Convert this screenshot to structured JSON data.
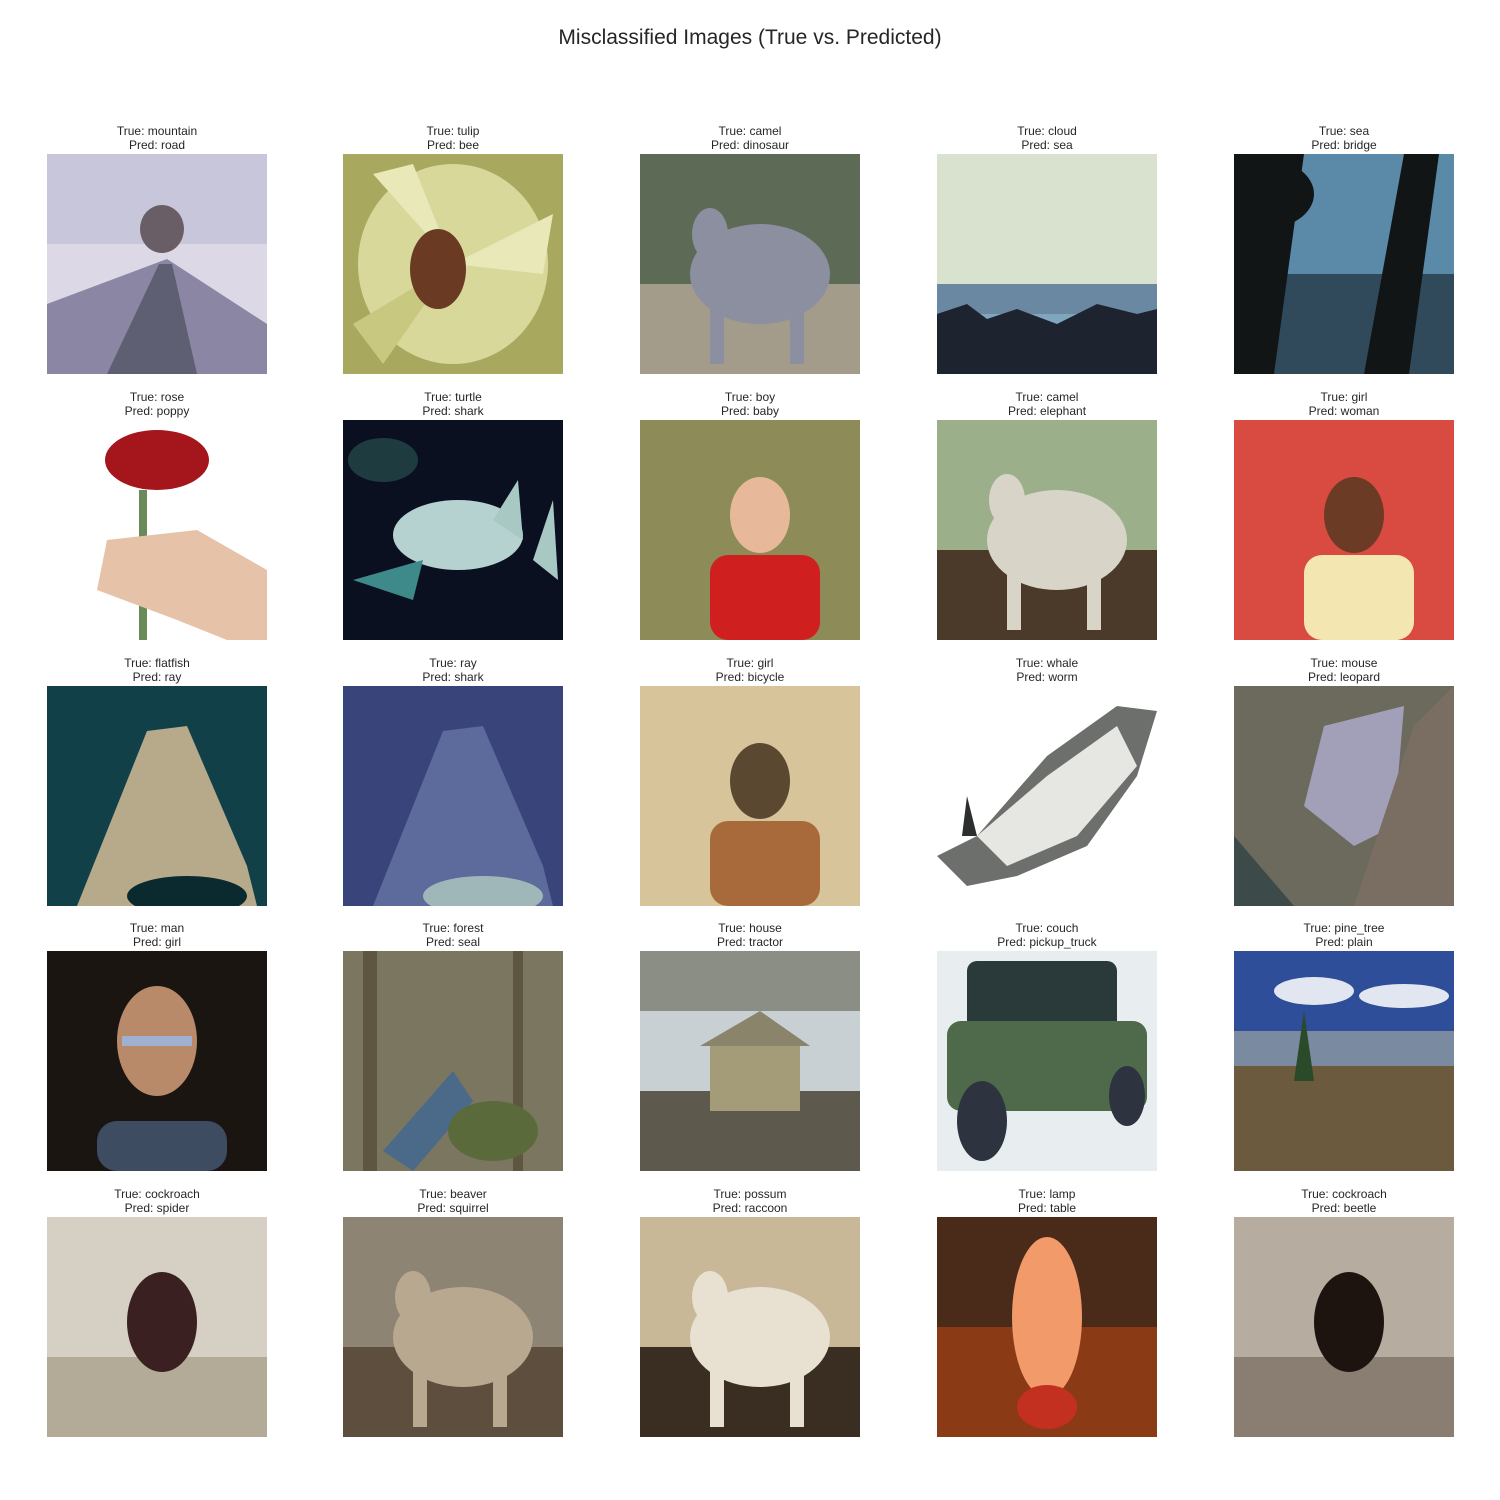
{
  "title": "Misclassified Images (True vs. Predicted)",
  "items": [
    {
      "true_label": "True: mountain",
      "pred_label": "Pred: road",
      "scene": "mountain-road",
      "colors": [
        "#dcd8e6",
        "#8a86a4",
        "#5e5f72"
      ]
    },
    {
      "true_label": "True: tulip",
      "pred_label": "Pred: bee",
      "scene": "flower",
      "colors": [
        "#a9a85f",
        "#d8d89a",
        "#6a3a22"
      ]
    },
    {
      "true_label": "True: camel",
      "pred_label": "Pred: dinosaur",
      "scene": "animal",
      "colors": [
        "#5d6a55",
        "#a49c8a",
        "#8b8fa0"
      ]
    },
    {
      "true_label": "True: cloud",
      "pred_label": "Pred: sea",
      "scene": "sky",
      "colors": [
        "#d9e2cf",
        "#7fa6bd",
        "#1d2430"
      ]
    },
    {
      "true_label": "True: sea",
      "pred_label": "Pred: bridge",
      "scene": "sea",
      "colors": [
        "#5b8aa8",
        "#304a5c",
        "#111516"
      ]
    },
    {
      "true_label": "True: rose",
      "pred_label": "Pred: poppy",
      "scene": "rose",
      "colors": [
        "#ffffff",
        "#a4161b",
        "#e6c3a8"
      ]
    },
    {
      "true_label": "True: turtle",
      "pred_label": "Pred: shark",
      "scene": "turtle",
      "colors": [
        "#0a1020",
        "#3e8a8a",
        "#b6d2d0"
      ]
    },
    {
      "true_label": "True: boy",
      "pred_label": "Pred: baby",
      "scene": "person",
      "colors": [
        "#8d8c58",
        "#d01f1f",
        "#e8b89a"
      ]
    },
    {
      "true_label": "True: camel",
      "pred_label": "Pred: elephant",
      "scene": "animal",
      "colors": [
        "#9bb08a",
        "#4b3a2a",
        "#d9d4c8"
      ]
    },
    {
      "true_label": "True: girl",
      "pred_label": "Pred: woman",
      "scene": "person",
      "colors": [
        "#d94a40",
        "#f4e6b0",
        "#6b3b25"
      ]
    },
    {
      "true_label": "True: flatfish",
      "pred_label": "Pred: ray",
      "scene": "fish",
      "colors": [
        "#124048",
        "#b6aa8a",
        "#0b2a2f"
      ]
    },
    {
      "true_label": "True: ray",
      "pred_label": "Pred: shark",
      "scene": "fish",
      "colors": [
        "#39457a",
        "#5c6a9c",
        "#9fb7b8"
      ]
    },
    {
      "true_label": "True: girl",
      "pred_label": "Pred: bicycle",
      "scene": "person",
      "colors": [
        "#d8c49a",
        "#a86a3a",
        "#5a4830"
      ]
    },
    {
      "true_label": "True: whale",
      "pred_label": "Pred: worm",
      "scene": "whale",
      "colors": [
        "#ffffff",
        "#6d6f6c",
        "#2d2f2e"
      ]
    },
    {
      "true_label": "True: mouse",
      "pred_label": "Pred: leopard",
      "scene": "rock",
      "colors": [
        "#6c6a5c",
        "#a1a0b8",
        "#3d4a4a"
      ]
    },
    {
      "true_label": "True: man",
      "pred_label": "Pred: girl",
      "scene": "face",
      "colors": [
        "#1a1510",
        "#b88a6a",
        "#3e4c62"
      ]
    },
    {
      "true_label": "True: forest",
      "pred_label": "Pred: seal",
      "scene": "forest",
      "colors": [
        "#7a7660",
        "#4b6a8a",
        "#c8c0a8"
      ]
    },
    {
      "true_label": "True: house",
      "pred_label": "Pred: tractor",
      "scene": "house",
      "colors": [
        "#8b8e84",
        "#a49c78",
        "#5d5a4d"
      ]
    },
    {
      "true_label": "True: couch",
      "pred_label": "Pred: pickup_truck",
      "scene": "couch",
      "colors": [
        "#e8eef0",
        "#4f6a4a",
        "#2a3a3a"
      ]
    },
    {
      "true_label": "True: pine_tree",
      "pred_label": "Pred: plain",
      "scene": "landscape",
      "colors": [
        "#2f4e9a",
        "#e2e6f0",
        "#6c5a3e"
      ]
    },
    {
      "true_label": "True: cockroach",
      "pred_label": "Pred: spider",
      "scene": "bug",
      "colors": [
        "#d6d0c4",
        "#3a2020",
        "#b3aa98"
      ]
    },
    {
      "true_label": "True: beaver",
      "pred_label": "Pred: squirrel",
      "scene": "animal",
      "colors": [
        "#8e8474",
        "#5e4e3e",
        "#b8a890"
      ]
    },
    {
      "true_label": "True: possum",
      "pred_label": "Pred: raccoon",
      "scene": "animal",
      "colors": [
        "#c8b898",
        "#3a2e22",
        "#e8e0d0"
      ]
    },
    {
      "true_label": "True: lamp",
      "pred_label": "Pred: table",
      "scene": "lamp",
      "colors": [
        "#8a3a14",
        "#f29a6a",
        "#c43020"
      ]
    },
    {
      "true_label": "True: cockroach",
      "pred_label": "Pred: beetle",
      "scene": "bug",
      "colors": [
        "#b6ada0",
        "#1d140f",
        "#8a7e72"
      ]
    }
  ]
}
